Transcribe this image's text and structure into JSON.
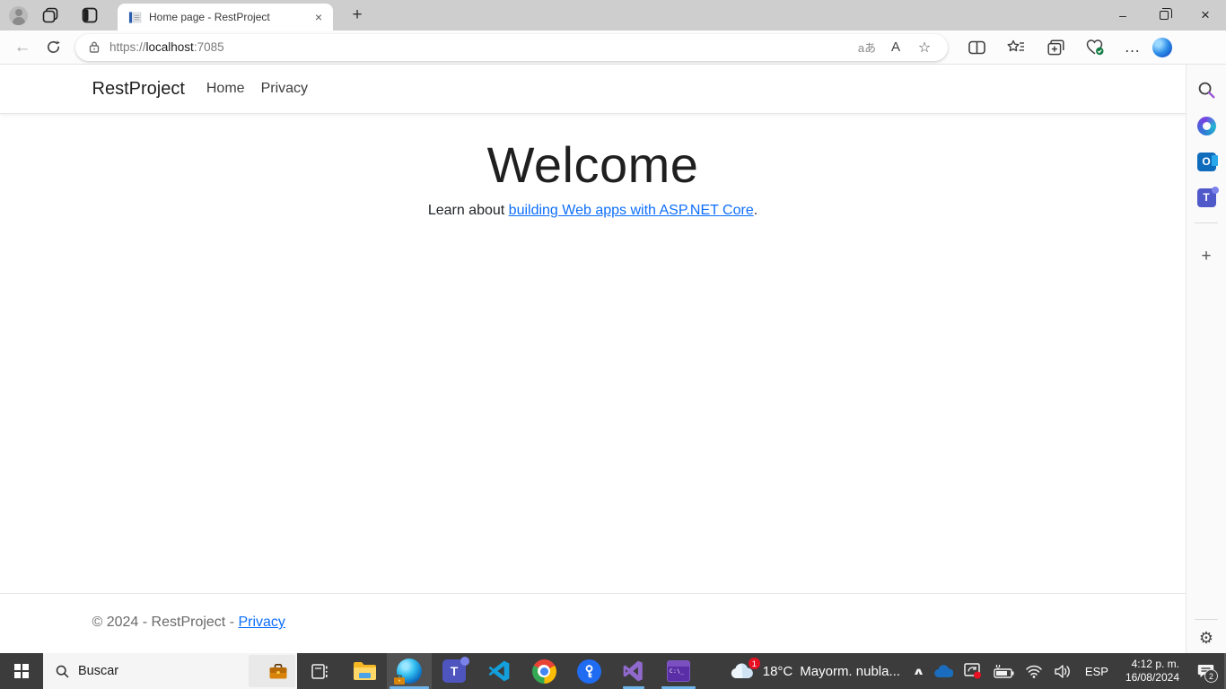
{
  "browser": {
    "tab": {
      "title": "Home page - RestProject",
      "close_glyph": "×"
    },
    "new_tab_glyph": "+",
    "window_controls": {
      "minimize_glyph": "–",
      "close_glyph": "×"
    },
    "toolbar": {
      "back_glyph": "←",
      "url": {
        "scheme": "https://",
        "host": "localhost",
        "port": ":7085"
      },
      "translate_glyph": "aあ",
      "read_aloud_glyph": "A",
      "favorite_star_glyph": "☆",
      "more_glyph": "…"
    },
    "sidebar": {
      "outlook_glyph": "O",
      "teams_glyph": "T",
      "add_glyph": "+",
      "settings_glyph": "⚙"
    }
  },
  "page": {
    "navbar": {
      "brand": "RestProject",
      "links": [
        {
          "label": "Home"
        },
        {
          "label": "Privacy"
        }
      ]
    },
    "heading": "Welcome",
    "intro": {
      "prefix": "Learn about ",
      "link": "building Web apps with ASP.NET Core",
      "suffix": "."
    },
    "footer": {
      "text": "© 2024 - RestProject - ",
      "link": "Privacy"
    }
  },
  "taskbar": {
    "search_placeholder": "Buscar",
    "teams_glyph": "T",
    "terminal_text": "C:\\_",
    "weather": {
      "badge": "1",
      "temp": "18°C",
      "condition": "Mayorm. nubla..."
    },
    "tray_chevron_glyph": "∧",
    "language": "ESP",
    "clock": {
      "time": "4:12 p. m.",
      "date": "16/08/2024"
    },
    "notifications_count": "2"
  },
  "colors": {
    "accent_link": "#0d6efd",
    "titlebar": "#cecece",
    "taskbar": "#3c3c3c",
    "taskbar_underline": "#6db3e8",
    "text": "#212529",
    "muted_text": "#6a6a6a"
  }
}
